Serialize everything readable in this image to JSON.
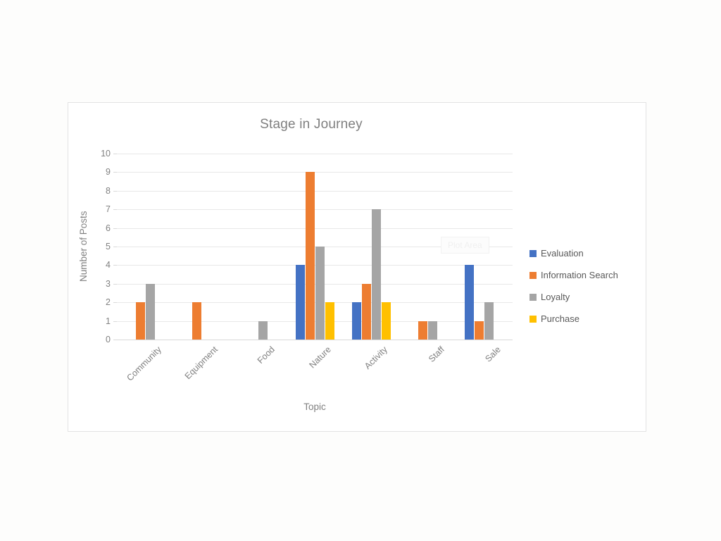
{
  "chart_data": {
    "type": "bar",
    "title": "Stage in Journey",
    "xlabel": "Topic",
    "ylabel": "Number of Posts",
    "categories": [
      "Community",
      "Equipment",
      "Food",
      "Nature",
      "Activity",
      "Staff",
      "Sale"
    ],
    "series": [
      {
        "name": "Evaluation",
        "color": "#4472C4",
        "values": [
          0,
          0,
          0,
          4,
          2,
          0,
          4
        ]
      },
      {
        "name": "Information Search",
        "color": "#ED7D31",
        "values": [
          2,
          2,
          0,
          9,
          3,
          1,
          1
        ]
      },
      {
        "name": "Loyalty",
        "color": "#A5A5A5",
        "values": [
          3,
          0,
          1,
          5,
          7,
          1,
          2
        ]
      },
      {
        "name": "Purchase",
        "color": "#FFC000",
        "values": [
          0,
          0,
          0,
          2,
          2,
          0,
          0
        ]
      }
    ],
    "ylim": [
      0,
      10
    ],
    "ytick_step": 1,
    "yticks": [
      "0",
      "1",
      "2",
      "3",
      "4",
      "5",
      "6",
      "7",
      "8",
      "9",
      "10"
    ],
    "grid": true,
    "legend_position": "right"
  },
  "overlay": {
    "plot_area_tooltip": "Plot Area"
  }
}
